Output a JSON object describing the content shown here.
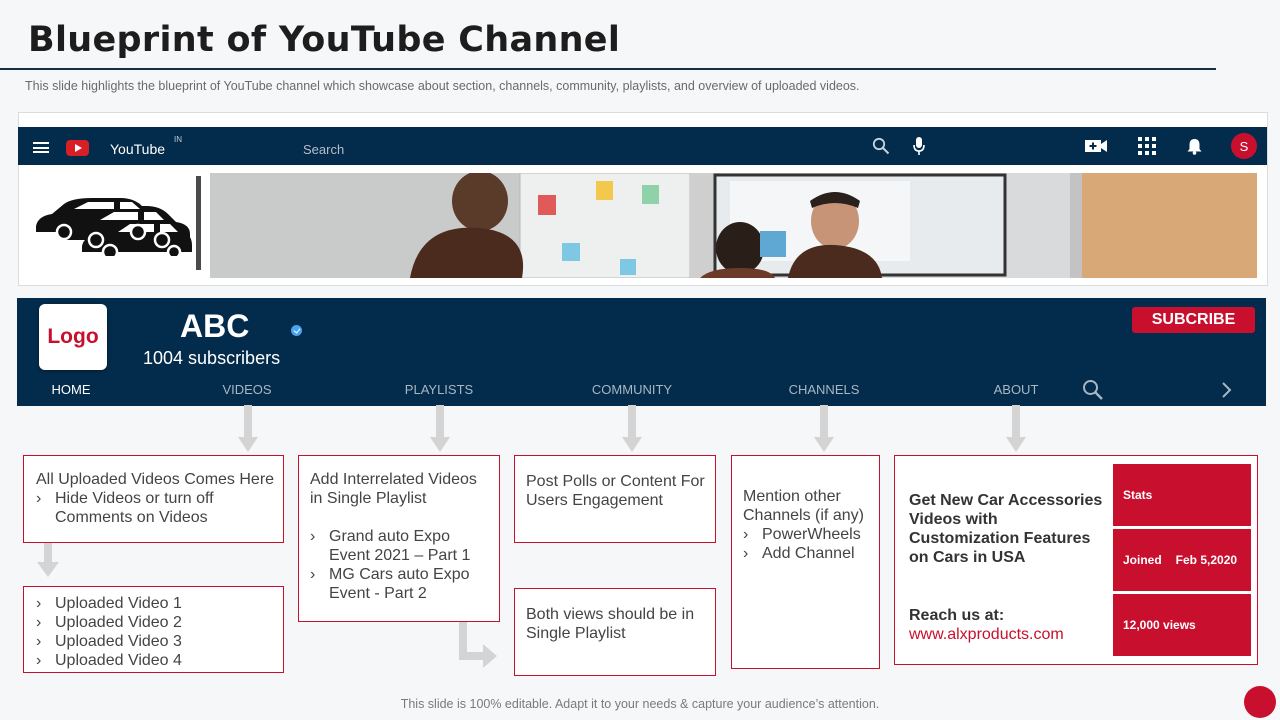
{
  "slide": {
    "title": "Blueprint of YouTube Channel",
    "subtitle": "This slide highlights the blueprint of YouTube channel which showcase about section, channels, community, playlists, and overview  of uploaded videos.",
    "footer": "This slide is 100% editable. Adapt it to your needs & capture your audience’s attention."
  },
  "topbar": {
    "app_name": "YouTube",
    "region": "IN",
    "search_placeholder": "Search",
    "avatar_letter": "S",
    "icons": [
      "menu-icon",
      "youtube-logo-icon",
      "search-icon",
      "microphone-icon",
      "create-video-icon",
      "apps-grid-icon",
      "bell-icon"
    ]
  },
  "channel": {
    "logo_text": "Logo",
    "name": "ABC",
    "subscribers": "1004 subscribers",
    "subscribe_label": "SUBCRIBE",
    "tabs": [
      "HOME",
      "VIDEOS",
      "PLAYLISTS",
      "COMMUNITY",
      "CHANNELS",
      "ABOUT"
    ],
    "active_tab": "HOME"
  },
  "boxes": {
    "home": {
      "heading": "All Uploaded Videos Comes Here",
      "bullets": [
        "Hide Videos or turn off Comments on Videos"
      ]
    },
    "home_videos": {
      "bullets": [
        "Uploaded Video 1",
        "Uploaded Video 2",
        "Uploaded Video 3",
        "Uploaded Video 4"
      ]
    },
    "playlists": {
      "heading": "Add Interrelated  Videos in Single Playlist",
      "bullets": [
        "Grand auto Expo Event 2021 – Part 1",
        "MG Cars auto Expo Event  - Part 2"
      ]
    },
    "community": {
      "text": "Post Polls or Content For Users Engagement"
    },
    "community_note": {
      "text": "Both views should be in Single Playlist"
    },
    "channels": {
      "heading": "Mention other Channels  (if any)",
      "bullets": [
        "PowerWheels",
        "Add Channel"
      ]
    },
    "about": {
      "description": "Get New Car Accessories Videos with Customization Features on Cars in USA",
      "reach_label": "Reach us at:",
      "url": "www.alxproducts.com",
      "stats_label": "Stats",
      "joined_label": "Joined",
      "joined_date": "Feb 5,2020",
      "views": "12,000 views"
    }
  },
  "colors": {
    "navy": "#032b4b",
    "accent_red": "#c8102e",
    "arrow_gray": "#d4d4d4"
  }
}
